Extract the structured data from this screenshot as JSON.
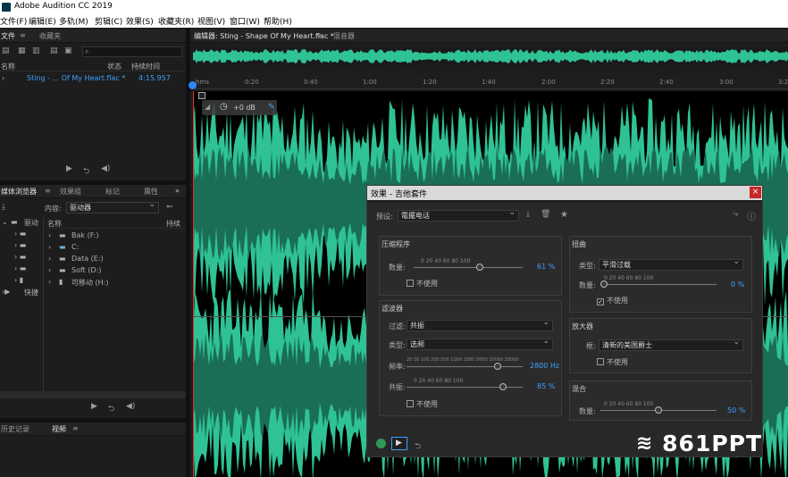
{
  "app": {
    "title": "Adobe Audition CC 2019"
  },
  "menu": [
    "文件(F)",
    "编辑(E)",
    "多轨(M)",
    "剪辑(C)",
    "效果(S)",
    "收藏夹(R)",
    "视图(V)",
    "窗口(W)",
    "帮助(H)"
  ],
  "files_panel": {
    "tabs": [
      "文件",
      "收藏夹"
    ],
    "columns": [
      "名称",
      "状态",
      "持续时间"
    ],
    "file": {
      "name": "Sting - ... Of My Heart.flac *",
      "duration": "4:15.957"
    }
  },
  "media_panel": {
    "tabs": [
      "媒体浏览器",
      "效果组",
      "标记",
      "属性"
    ],
    "content_label": "内容:",
    "content_value": "驱动器",
    "tree_col": "名称",
    "dur_col": "持续",
    "left_items": [
      "驱动",
      "快捷"
    ],
    "drives": [
      "Bak (F:)",
      "C:",
      "Data (E:)",
      "Soft (D:)",
      "可移动 (H:)"
    ]
  },
  "bottom_tabs": [
    "历史记录",
    "视频"
  ],
  "editor": {
    "tabs": [
      "编辑器: Sting - Shape Of My Heart.flac *",
      "混音器"
    ],
    "ruler": [
      "hms",
      "0:20",
      "0:40",
      "1:00",
      "1:20",
      "1:40",
      "2:00",
      "2:20",
      "2:40",
      "3:00",
      "3:20"
    ],
    "volume": "+0 dB",
    "wave_color": "#2fc294"
  },
  "dialog": {
    "title": "效果 - 吉他套件",
    "close": "×",
    "preset_label": "预设:",
    "preset_value": "電擺电话",
    "compressor": {
      "title": "压缩程序",
      "amount_label": "数量:",
      "ticks": "0    20    40    60    80    100",
      "value": "61 %",
      "amount": 61,
      "disable": "不使用"
    },
    "filter": {
      "title": "滤波器",
      "filter_label": "过滤:",
      "filter_value": "共振",
      "type_label": "类型:",
      "type_value": "选频",
      "freq_label": "频率:",
      "freq_ticks": "20  50  100 200 500 1000 2000 5000 10000 20000",
      "freq_value": "2800 Hz",
      "freq_pos": 0.8,
      "res_label": "共振:",
      "res_ticks": "0    20    40    60    80    100",
      "res_value": "85 %",
      "res": 85,
      "disable": "不使用"
    },
    "distortion": {
      "title": "扭曲",
      "type_label": "类型:",
      "type_value": "平滑过载",
      "amount_label": "数量:",
      "ticks": "0    20    40    60    80    100",
      "value": "0 %",
      "amount": 0,
      "disable": "不使用",
      "disabled": true
    },
    "amplifier": {
      "title": "放大器",
      "box_label": "框:",
      "box_value": "清新的美国爵士",
      "disable": "不使用"
    },
    "mix": {
      "title": "混合",
      "amount_label": "数量:",
      "ticks": "0    20    40    60    80    100",
      "value": "50 %",
      "amount": 50
    }
  },
  "watermark": "861PPT"
}
